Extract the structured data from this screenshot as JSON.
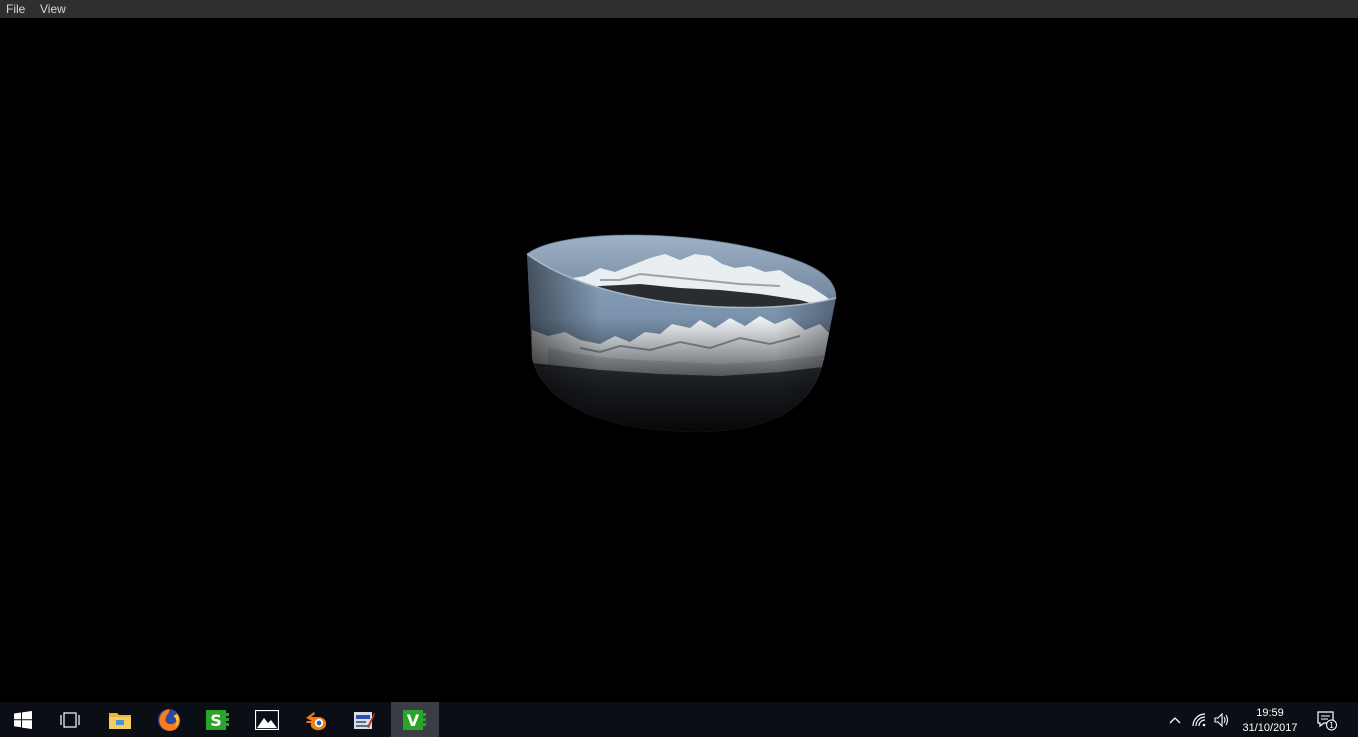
{
  "menu": {
    "file": "File",
    "view": "View"
  },
  "taskbar": {
    "items": [
      {
        "name": "start-icon"
      },
      {
        "name": "task-view-icon"
      },
      {
        "name": "file-explorer-icon"
      },
      {
        "name": "firefox-icon"
      },
      {
        "name": "s-app-icon",
        "glyph": "S"
      },
      {
        "name": "photos-icon"
      },
      {
        "name": "blender-icon"
      },
      {
        "name": "image-editor-icon"
      },
      {
        "name": "v-app-icon",
        "glyph": "V",
        "active": true
      }
    ],
    "tray": {
      "time": "19:59",
      "date": "31/10/2017",
      "notification_count": "1"
    }
  },
  "colors": {
    "menubar": "#2f2f2f",
    "taskbar": "#0b0e14",
    "accent_green": "#2aa52a",
    "sky": "#8ea6bf"
  }
}
